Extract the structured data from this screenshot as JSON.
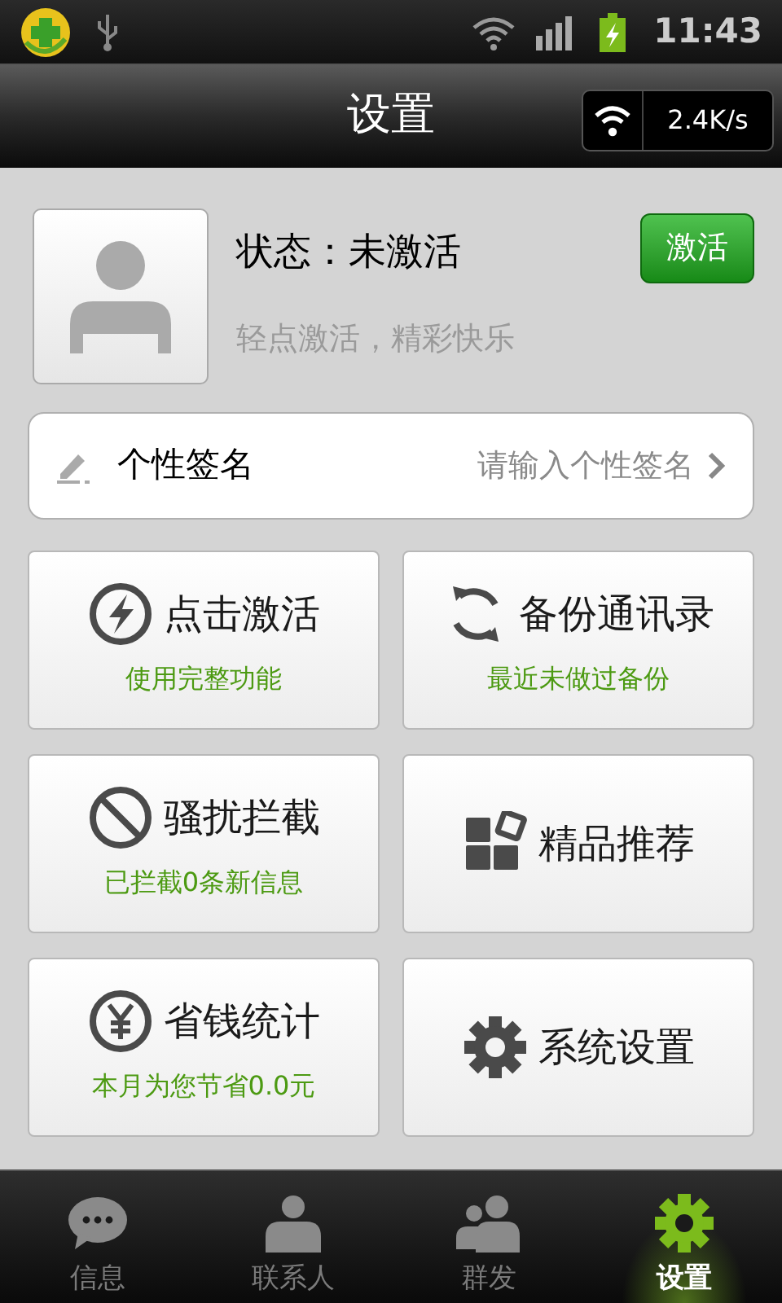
{
  "status_bar": {
    "time": "11:43"
  },
  "header": {
    "title": "设置",
    "speed": "2.4K/s"
  },
  "profile": {
    "status": "状态：未激活",
    "hint": "轻点激活，精彩快乐",
    "button": "激活"
  },
  "signature": {
    "label": "个性签名",
    "placeholder": "请输入个性签名"
  },
  "tiles": [
    {
      "title": "点击激活",
      "subtitle": "使用完整功能"
    },
    {
      "title": "备份通讯录",
      "subtitle": "最近未做过备份"
    },
    {
      "title": "骚扰拦截",
      "subtitle": "已拦截0条新信息"
    },
    {
      "title": "精品推荐"
    },
    {
      "title": "省钱统计",
      "subtitle": "本月为您节省0.0元"
    },
    {
      "title": "系统设置"
    }
  ],
  "tabs": [
    {
      "label": "信息",
      "selected": false
    },
    {
      "label": "联系人",
      "selected": false
    },
    {
      "label": "群发",
      "selected": false
    },
    {
      "label": "设置",
      "selected": true
    }
  ]
}
